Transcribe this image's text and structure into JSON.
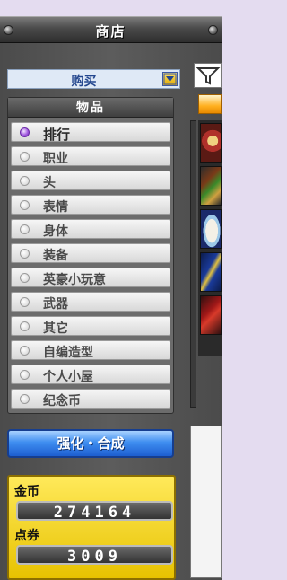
{
  "window": {
    "title": "商店"
  },
  "shop": {
    "dropdown": {
      "selected": "购买",
      "arrow_icon": "chevron-down-icon"
    },
    "category_header": "物品",
    "categories": [
      {
        "label": "排行",
        "selected": true
      },
      {
        "label": "职业",
        "selected": false
      },
      {
        "label": "头",
        "selected": false
      },
      {
        "label": "表情",
        "selected": false
      },
      {
        "label": "身体",
        "selected": false
      },
      {
        "label": "装备",
        "selected": false
      },
      {
        "label": "英豪小玩意",
        "selected": false
      },
      {
        "label": "武器",
        "selected": false
      },
      {
        "label": "其它",
        "selected": false
      },
      {
        "label": "自编造型",
        "selected": false
      },
      {
        "label": "个人小屋",
        "selected": false
      },
      {
        "label": "纪念币",
        "selected": false
      }
    ],
    "enhance_button": "强化・合成"
  },
  "wallet": {
    "gold_label": "金币",
    "gold_value": "274164",
    "points_label": "点券",
    "points_value": "3009"
  },
  "items": {
    "filter_icon": "filter-funnel-icon",
    "slots": [
      "badge-item-icon",
      "hammer-item-icon",
      "egg-item-icon",
      "spear-item-icon",
      "claw-item-icon"
    ]
  },
  "colors": {
    "title_bar": "#4a4a4a",
    "panel": "#555555",
    "accent_blue": "#3f8ef0",
    "gold_panel": "#f2d21c",
    "selected_radio": "#a25ae0"
  }
}
